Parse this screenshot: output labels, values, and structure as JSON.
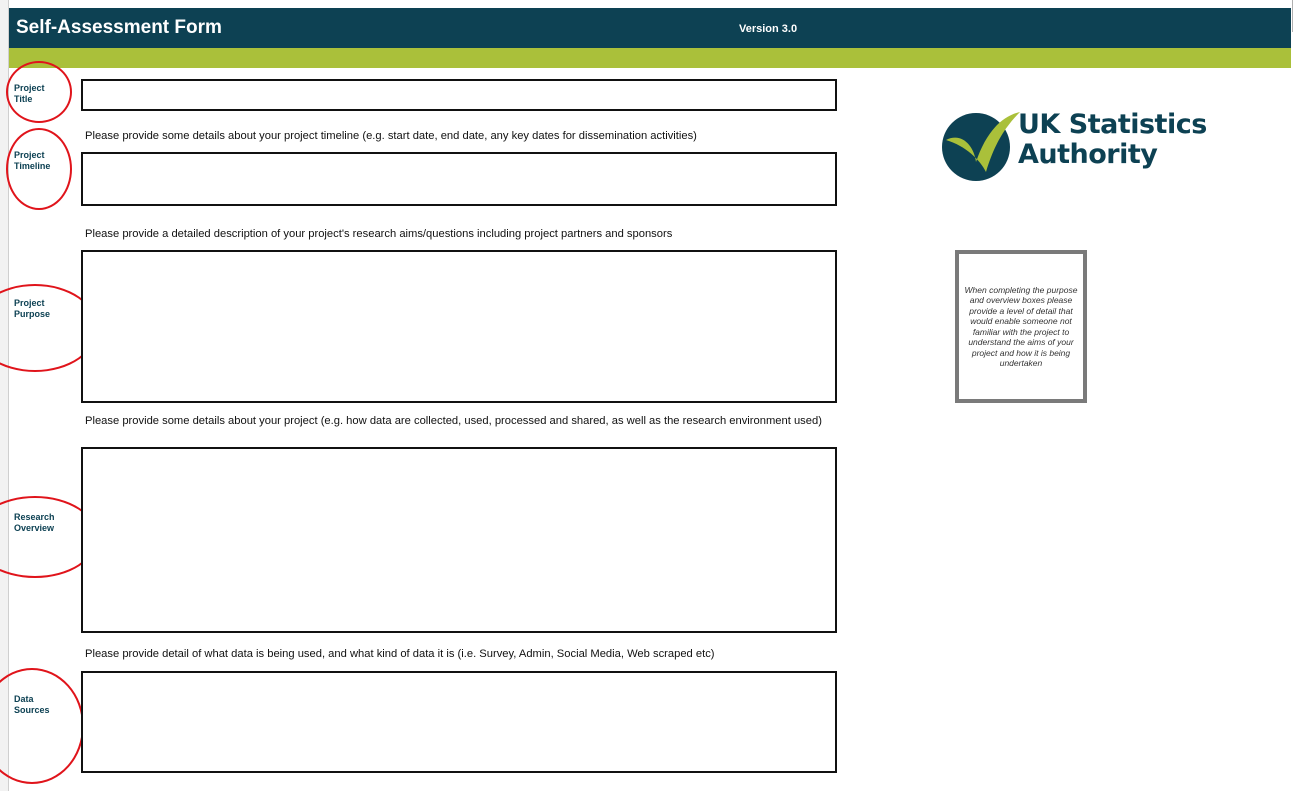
{
  "header": {
    "title": "Self-Assessment Form",
    "version": "Version 3.0"
  },
  "brand": {
    "logo_line1": "UK Statistics",
    "logo_line2": "Authority",
    "colors": {
      "header_bg": "#0d4153",
      "accent_green": "#aac03a",
      "annotation_red": "#e0141b"
    }
  },
  "guidance_note": "When completing the purpose and overview boxes please provide a level of detail that would enable someone not familiar with the project to understand the aims of your project and how it is being undertaken",
  "fields": {
    "title": {
      "label_line1": "Project",
      "label_line2": "Title",
      "value": ""
    },
    "timeline": {
      "label_line1": "Project",
      "label_line2": "Timeline",
      "hint": "Please provide some details about your project timeline (e.g. start date, end date, any key dates for dissemination activities)",
      "value": ""
    },
    "purpose": {
      "label_line1": "Project",
      "label_line2": "Purpose",
      "hint": "Please provide a detailed description of your project's research aims/questions including project partners and sponsors",
      "value": ""
    },
    "overview": {
      "label_line1": "Research",
      "label_line2": "Overview",
      "hint": "Please provide some details about your project (e.g. how data are collected, used, processed and shared, as well as the research environment used)",
      "value": ""
    },
    "sources": {
      "label_line1": "Data",
      "label_line2": "Sources",
      "hint": "Please provide detail of what data is being used, and what kind of data it is (i.e. Survey, Admin, Social Media, Web scraped etc)",
      "value": ""
    }
  }
}
